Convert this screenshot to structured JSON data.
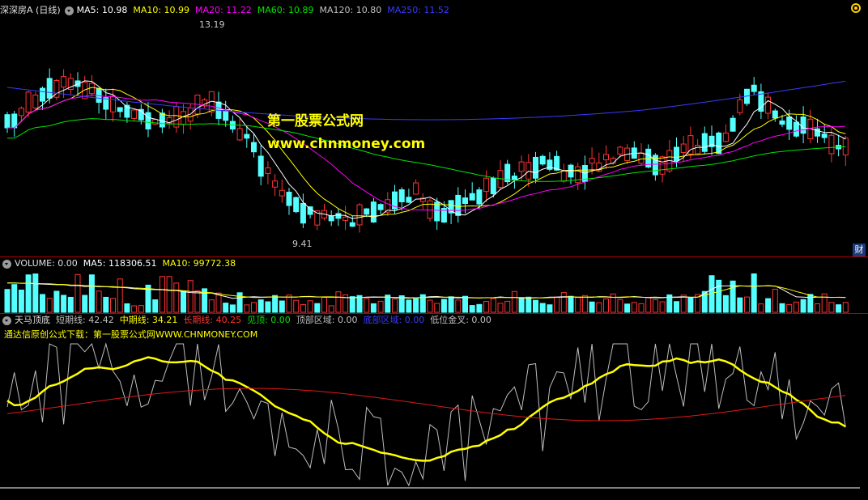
{
  "main": {
    "title": "深深房A (日线)",
    "ma5": "MA5: 10.98",
    "ma10": "MA10: 10.99",
    "ma20": "MA20: 11.22",
    "ma60": "MA60: 10.89",
    "ma120": "MA120: 10.80",
    "ma250": "MA250: 11.52",
    "high_label": "13.19",
    "low_label": "9.41",
    "watermark_cn": "第一股票公式网",
    "watermark_url": "www.chnmoney.com",
    "side_button": "财"
  },
  "volume": {
    "vol": "VOLUME: 0.00",
    "ma5": "MA5: 118306.51",
    "ma10": "MA10: 99772.38"
  },
  "indicator": {
    "name": "天马顶底",
    "short": "短期线: 42.42",
    "mid": "中期线: 34.21",
    "long": "长期线: 40.25",
    "top": "见顶: 0.00",
    "top_zone": "顶部区域: 0.00",
    "bottom_zone": "底部区域: 0.00",
    "low_cross": "低位金叉: 0.00",
    "subtitle": "通达信原创公式下载：第一股票公式网WWW.CHNMONEY.COM"
  },
  "colors": {
    "up": "#ff3232",
    "down": "#54ffff",
    "ma5": "#ffffff",
    "ma10": "#ffff00",
    "ma20": "#ff00ff",
    "ma60": "#00e600",
    "ma120": "#c0c0c0",
    "ma250": "#3a3aff"
  }
}
